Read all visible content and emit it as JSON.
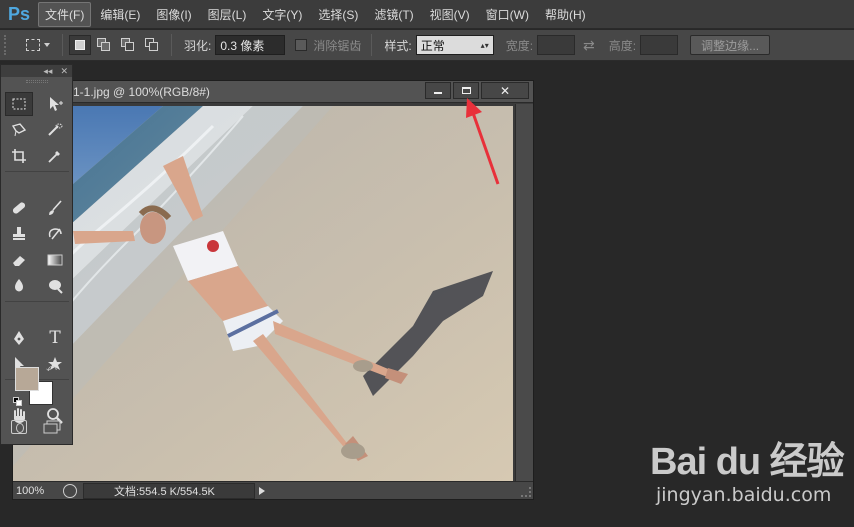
{
  "app": {
    "logo": "Ps"
  },
  "menu": [
    {
      "label": "文件(F)",
      "active": true
    },
    {
      "label": "编辑(E)"
    },
    {
      "label": "图像(I)"
    },
    {
      "label": "图层(L)"
    },
    {
      "label": "文字(Y)"
    },
    {
      "label": "选择(S)"
    },
    {
      "label": "滤镜(T)"
    },
    {
      "label": "视图(V)"
    },
    {
      "label": "窗口(W)"
    },
    {
      "label": "帮助(H)"
    }
  ],
  "options": {
    "feather_label": "羽化:",
    "feather_value": "0.3 像素",
    "antialias_label": "消除锯齿",
    "style_label": "样式:",
    "style_value": "正常",
    "width_label": "宽度:",
    "height_label": "高度:",
    "refine_edge_label": "调整边缘..."
  },
  "toolbox": {
    "header_collapse": "◂◂",
    "header_close": "✕",
    "foreground_color": "#b7a897",
    "background_color": "#ffffff"
  },
  "document": {
    "title": "1-1.jpg @ 100%(RGB/8#)",
    "zoom": "100%",
    "doc_info": "文档:554.5 K/554.5K"
  },
  "watermark": {
    "brand": "Bai du 经验",
    "url": "jingyan.baidu.com"
  },
  "colors": {
    "annotation_arrow": "#e8303a",
    "ps_blue": "#4fa8e0"
  }
}
